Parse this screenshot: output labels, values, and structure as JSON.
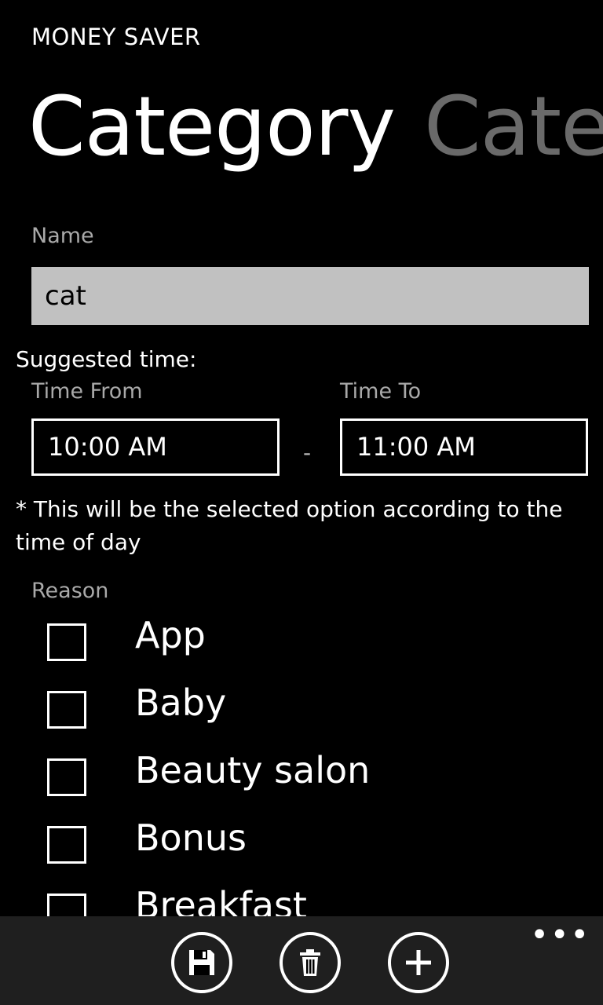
{
  "app": {
    "title": "MONEY SAVER"
  },
  "pivot": {
    "active": "Category",
    "next": "Cate"
  },
  "name": {
    "label": "Name",
    "value": "cat"
  },
  "suggested": {
    "label": "Suggested time:"
  },
  "time_from": {
    "label": "Time From",
    "value": "10:00 AM"
  },
  "time_to": {
    "label": "Time To",
    "value": "11:00 AM"
  },
  "separator": "-",
  "note": "* This will be the selected option according to the time of day",
  "reason": {
    "label": "Reason",
    "items": [
      {
        "label": "App",
        "checked": false
      },
      {
        "label": "Baby",
        "checked": false
      },
      {
        "label": "Beauty salon",
        "checked": false
      },
      {
        "label": "Bonus",
        "checked": false
      },
      {
        "label": "Breakfast",
        "checked": false
      }
    ]
  },
  "app_bar": {
    "buttons": [
      {
        "icon": "save-icon"
      },
      {
        "icon": "delete-icon"
      },
      {
        "icon": "add-icon"
      }
    ],
    "more": "•••"
  }
}
